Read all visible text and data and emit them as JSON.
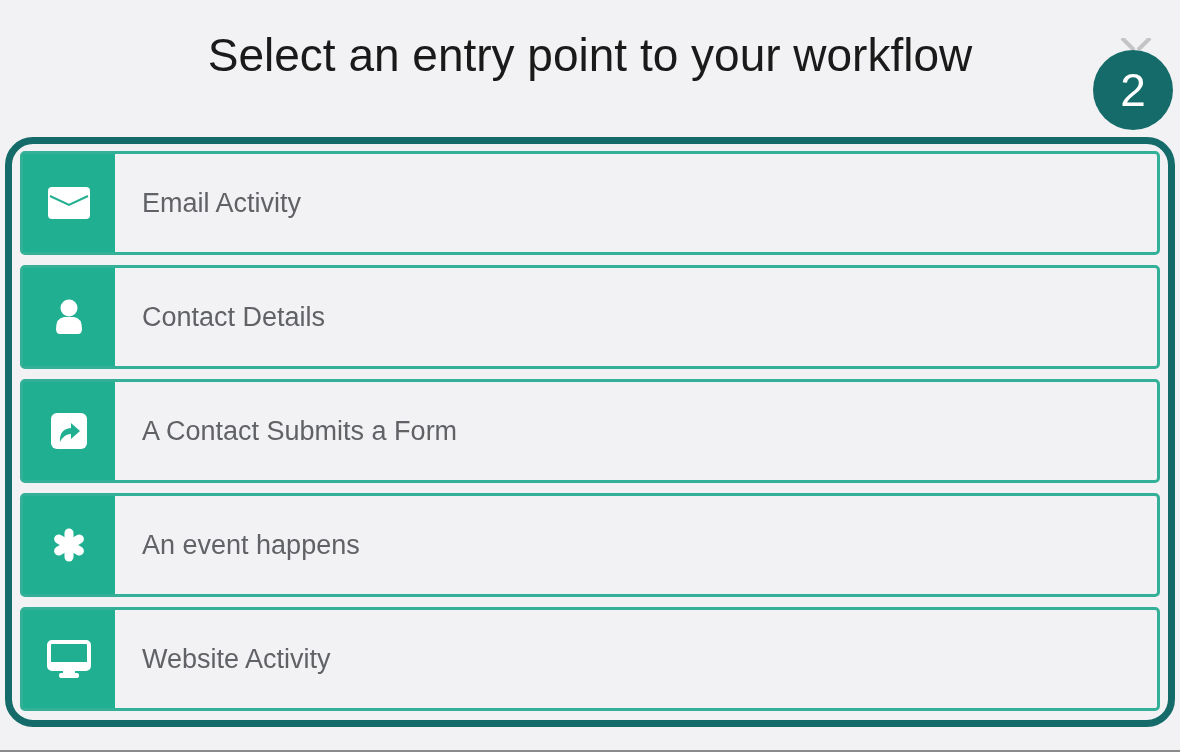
{
  "title": "Select an entry point to your workflow",
  "step_badge": "2",
  "entry_points": [
    {
      "kind": "email",
      "label": "Email Activity"
    },
    {
      "kind": "person",
      "label": "Contact Details"
    },
    {
      "kind": "share",
      "label": "A Contact Submits a Form"
    },
    {
      "kind": "asterisk",
      "label": "An event happens"
    },
    {
      "kind": "monitor",
      "label": "Website Activity"
    }
  ]
}
